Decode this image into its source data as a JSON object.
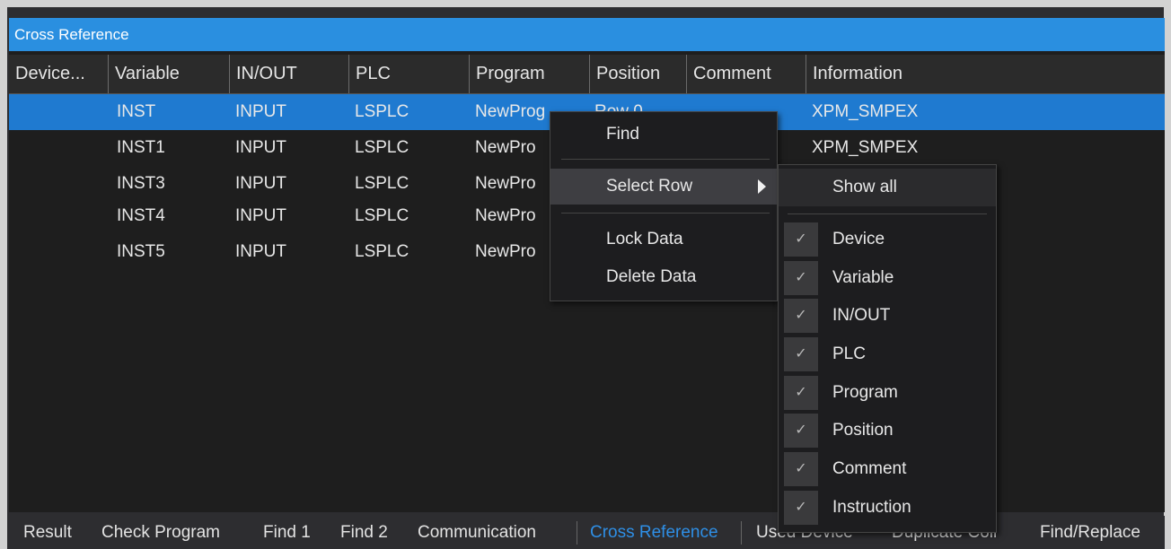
{
  "window": {
    "title": "Cross Reference"
  },
  "grid": {
    "columns": [
      "Device...",
      "Variable",
      "IN/OUT",
      "PLC",
      "Program",
      "Position",
      "Comment",
      "Information"
    ],
    "rows": [
      {
        "device": "",
        "variable": "INST",
        "inout": "INPUT",
        "plc": "LSPLC",
        "program": "NewProg",
        "position": "Row 0",
        "comment": "",
        "information": "XPM_SMPEX"
      },
      {
        "device": "",
        "variable": "INST1",
        "inout": "INPUT",
        "plc": "LSPLC",
        "program": "NewPro",
        "position": "",
        "comment": "",
        "information": "XPM_SMPEX"
      },
      {
        "device": "",
        "variable": "INST3",
        "inout": "INPUT",
        "plc": "LSPLC",
        "program": "NewPro",
        "position": "",
        "comment": "",
        "information": ""
      },
      {
        "device": "",
        "variable": "INST4",
        "inout": "INPUT",
        "plc": "LSPLC",
        "program": "NewPro",
        "position": "",
        "comment": "",
        "information": ""
      },
      {
        "device": "",
        "variable": "INST5",
        "inout": "INPUT",
        "plc": "LSPLC",
        "program": "NewPro",
        "position": "",
        "comment": "",
        "information": ""
      }
    ]
  },
  "context_menu": {
    "items": [
      "Find",
      "Select Row",
      "Lock Data",
      "Delete Data"
    ]
  },
  "select_row_submenu": {
    "show_all": "Show all",
    "check_glyph": "✓",
    "items": [
      "Device",
      "Variable",
      "IN/OUT",
      "PLC",
      "Program",
      "Position",
      "Comment",
      "Instruction"
    ]
  },
  "bottom_tabs": {
    "items": [
      "Result",
      "Check Program",
      "Find 1",
      "Find 2",
      "Communication",
      "Cross Reference",
      "Used Device",
      "Duplicate Coil",
      "Find/Replace"
    ],
    "active": "Cross Reference"
  },
  "colors": {
    "accent": "#2a8fe0",
    "selected_row": "#1f7ad0",
    "background": "#1e1e1e"
  }
}
